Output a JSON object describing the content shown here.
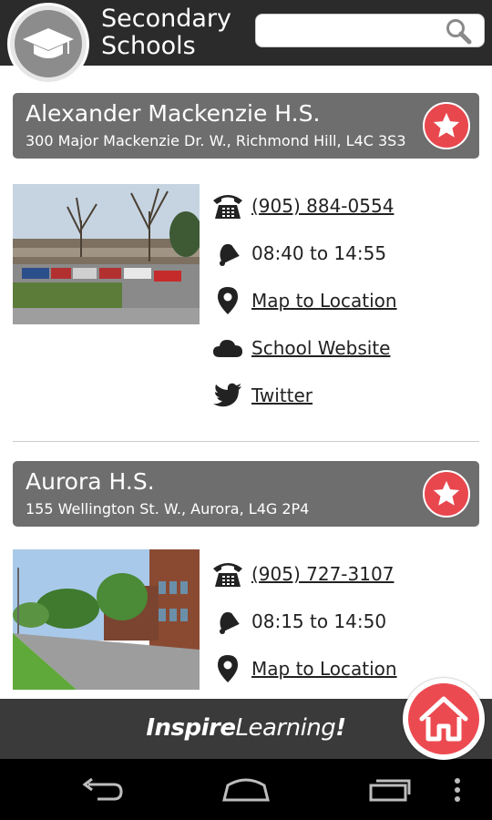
{
  "header": {
    "title_line1": "Secondary",
    "title_line2": "Schools",
    "search_placeholder": "",
    "icons": {
      "logo": "graduation-cap-icon",
      "search": "search-icon"
    }
  },
  "schools": [
    {
      "name": "Alexander Mackenzie H.S.",
      "address": "300 Major Mackenzie Dr. W., Richmond Hill, L4C 3S3",
      "phone": "(905) 884-0554",
      "hours": "08:40 to 14:55",
      "map_label": "Map to Location",
      "website_label": "School Website",
      "twitter_label": "Twitter"
    },
    {
      "name": "Aurora H.S.",
      "address": "155 Wellington St. W., Aurora, L4G 2P4",
      "phone": "(905) 727-3107",
      "hours": "08:15 to 14:50",
      "map_label": "Map to Location"
    }
  ],
  "footer": {
    "brand_bold": "Inspire",
    "brand_rest": "Learning",
    "brand_mark": "!"
  },
  "colors": {
    "header_bg": "#2b2b2b",
    "banner_bg": "#6e6e6e",
    "accent_red": "#e8474e",
    "footer_bg": "#3a3a3a"
  }
}
